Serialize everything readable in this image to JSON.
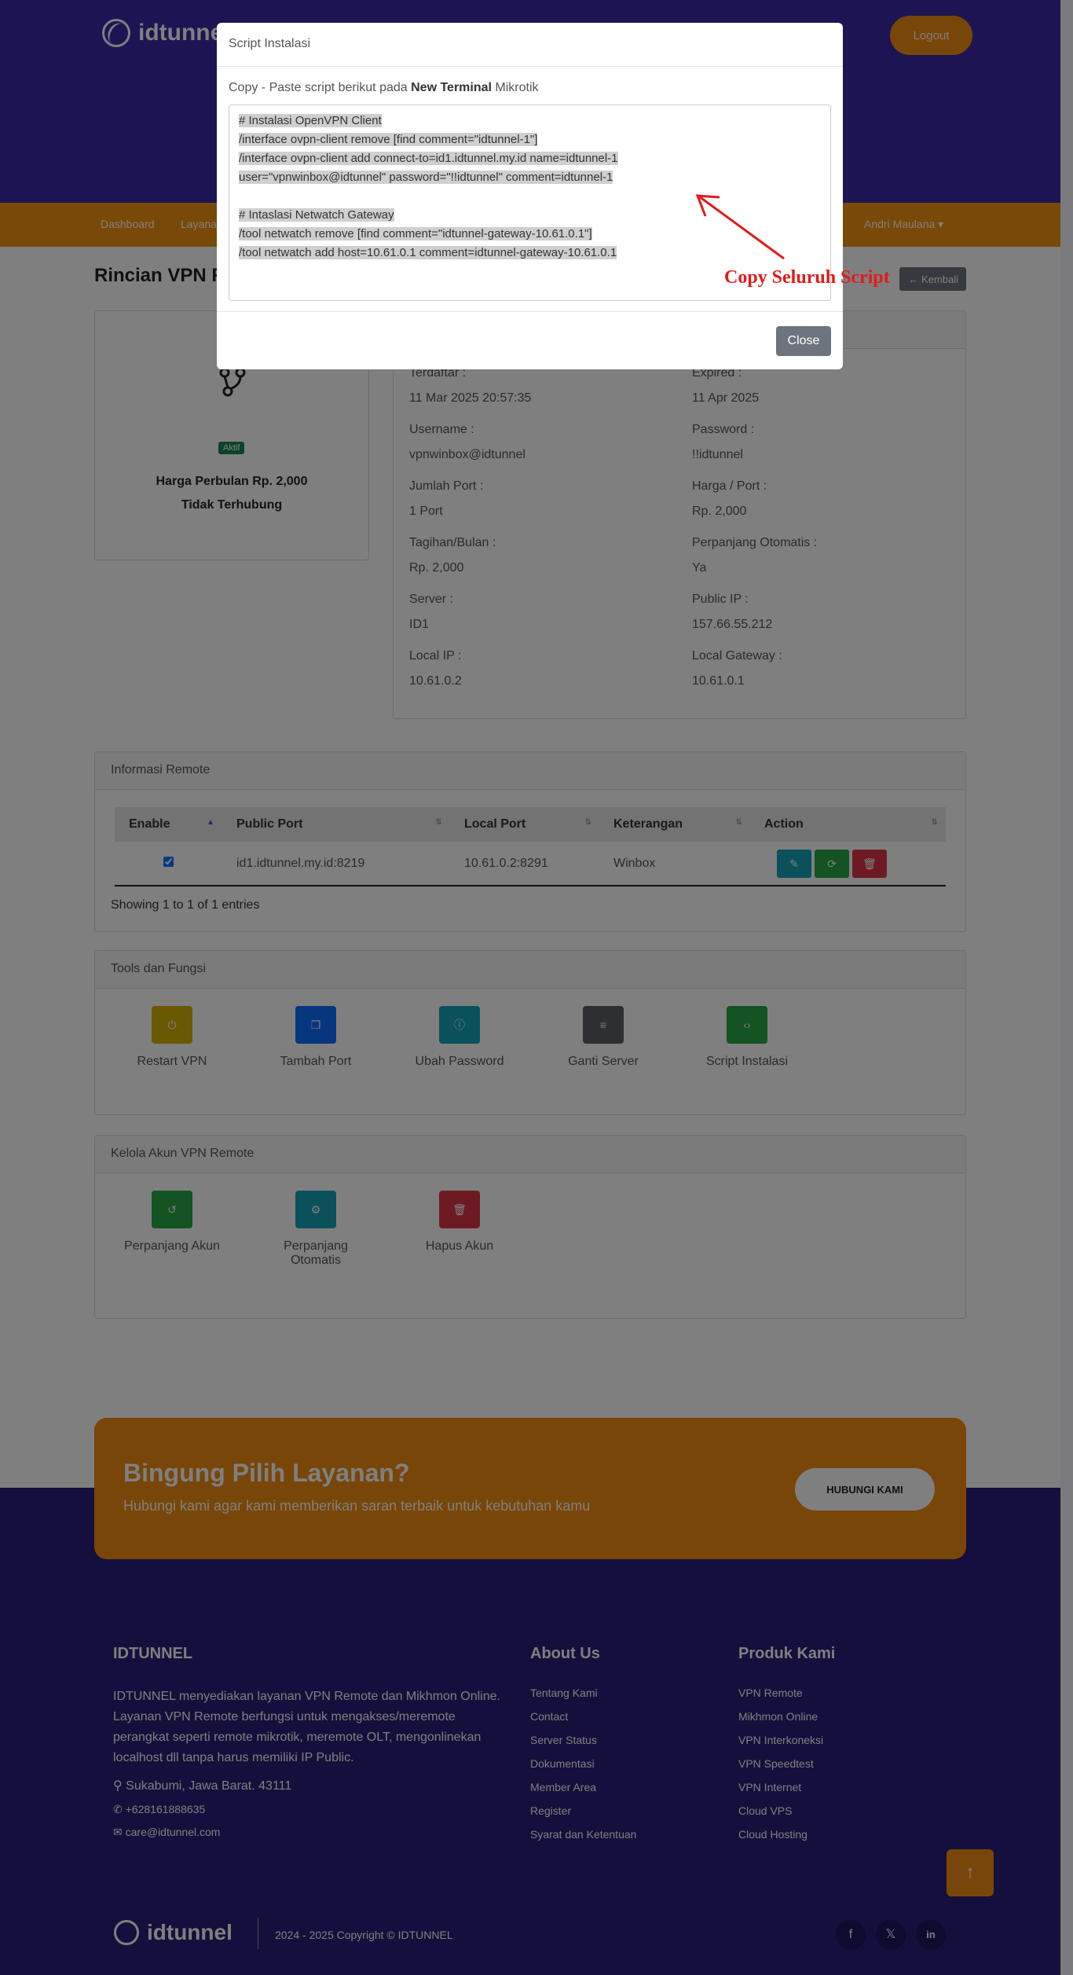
{
  "header": {
    "brand": "idtunnel",
    "logout_label": "Logout"
  },
  "nav": {
    "items": [
      "Dashboard",
      "Layanan"
    ],
    "user": "Andri Maulana ▾"
  },
  "page": {
    "title": "Rincian VPN Remote",
    "back_label": "← Kembali"
  },
  "left_card": {
    "status_badge": "Aktif",
    "price": "Harga Perbulan Rp. 2,000",
    "connection": "Tidak Terhubung"
  },
  "details": [
    {
      "label": "Terdaftar :",
      "value": "11 Mar 2025 20:57:35"
    },
    {
      "label": "Expired :",
      "value": "11 Apr 2025"
    },
    {
      "label": "Username :",
      "value": "vpnwinbox@idtunnel"
    },
    {
      "label": "Password :",
      "value": "!!idtunnel"
    },
    {
      "label": "Jumlah Port :",
      "value": "1 Port"
    },
    {
      "label": "Harga / Port :",
      "value": "Rp. 2,000"
    },
    {
      "label": "Tagihan/Bulan :",
      "value": "Rp. 2,000"
    },
    {
      "label": "Perpanjang Otomatis :",
      "value": "Ya"
    },
    {
      "label": "Server :",
      "value": "ID1"
    },
    {
      "label": "Public IP :",
      "value": "157.66.55.212"
    },
    {
      "label": "Local IP :",
      "value": "10.61.0.2"
    },
    {
      "label": "Local Gateway :",
      "value": "10.61.0.1"
    }
  ],
  "remote": {
    "title": "Informasi Remote",
    "columns": [
      "Enable",
      "Public Port",
      "Local Port",
      "Keterangan",
      "Action"
    ],
    "rows": [
      {
        "public_port": "id1.idtunnel.my.id:8219",
        "local_port": "10.61.0.2:8291",
        "keterangan": "Winbox"
      }
    ],
    "showing": "Showing 1 to 1 of 1 entries"
  },
  "tools": {
    "title": "Tools dan Fungsi",
    "items": [
      {
        "label": "Restart VPN",
        "color": "#d4b106",
        "icon": "power-icon",
        "glyph": "⏻"
      },
      {
        "label": "Tambah Port",
        "color": "#0d6efd",
        "icon": "copy-icon",
        "glyph": "❐"
      },
      {
        "label": "Ubah Password",
        "color": "#17a2b8",
        "icon": "info-icon",
        "glyph": "ⓘ"
      },
      {
        "label": "Ganti Server",
        "color": "#5a5f66",
        "icon": "server-icon",
        "glyph": "≡"
      },
      {
        "label": "Script Instalasi",
        "color": "#28a745",
        "icon": "code-icon",
        "glyph": "‹›"
      }
    ]
  },
  "akun": {
    "title": "Kelola Akun VPN Remote",
    "items": [
      {
        "label": "Perpanjang Akun",
        "color": "#28a745",
        "icon": "history-icon",
        "glyph": "↺"
      },
      {
        "label": "Perpanjang Otomatis",
        "color": "#17a2b8",
        "icon": "gear-icon",
        "glyph": "⚙"
      },
      {
        "label": "Hapus Akun",
        "color": "#dc3545",
        "icon": "trash-icon",
        "glyph": "🗑"
      }
    ]
  },
  "cta": {
    "title": "Bingung Pilih Layanan?",
    "subtitle": "Hubungi kami agar kami memberikan saran terbaik untuk kebutuhan kamu",
    "button": "HUBUNGI KAMI"
  },
  "footer": {
    "about_title": "IDTUNNEL",
    "about_text": "IDTUNNEL menyediakan layanan VPN Remote dan Mikhmon Online. Layanan VPN Remote berfungsi untuk mengakses/meremote perangkat seperti remote mikrotik, meremote OLT, mengonlinekan localhost dll tanpa harus memiliki IP Public.",
    "address": "Sukabumi, Jawa Barat. 43111",
    "phone": "+628161888635",
    "email": "care@idtunnel.com",
    "about_us_title": "About Us",
    "about_us_links": [
      "Tentang Kami",
      "Contact",
      "Server Status",
      "Dokumentasi",
      "Member Area",
      "Register",
      "Syarat dan Ketentuan"
    ],
    "produk_title": "Produk Kami",
    "produk_links": [
      "VPN Remote",
      "Mikhmon Online",
      "VPN Interkoneksi",
      "VPN Speedtest",
      "VPN Internet",
      "Cloud VPS",
      "Cloud Hosting"
    ],
    "logo": "idtunnel",
    "copyright": "2024 - 2025 Copyright © IDTUNNEL"
  },
  "modal": {
    "title": "Script Instalasi",
    "intro_prefix": "Copy - Paste script berikut pada ",
    "intro_bold": "New Terminal",
    "intro_suffix": " Mikrotik",
    "script_lines": [
      "# Instalasi OpenVPN Client",
      "/interface ovpn-client remove [find comment=\"idtunnel-1\"]",
      "/interface ovpn-client add connect-to=id1.idtunnel.my.id name=idtunnel-1",
      "user=\"vpnwinbox@idtunnel\" password=\"!!idtunnel\" comment=idtunnel-1",
      "",
      "# Intaslasi Netwatch Gateway",
      "/tool netwatch remove [find comment=\"idtunnel-gateway-10.61.0.1\"]",
      "/tool netwatch add host=10.61.0.1 comment=idtunnel-gateway-10.61.0.1"
    ],
    "annotation": "Copy Seluruh Script",
    "close_label": "Close"
  },
  "colors": {
    "primary": "#3b2aa7",
    "accent": "#f3920f",
    "annotation": "#e21b1b"
  }
}
